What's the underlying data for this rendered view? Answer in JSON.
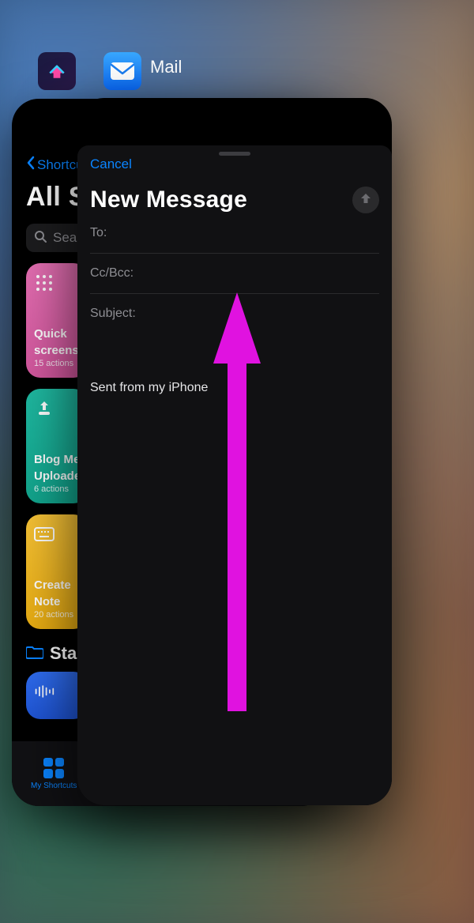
{
  "shortcuts": {
    "app_name": "Shortcuts",
    "back_label": "Shortcuts",
    "title": "All Shortcuts",
    "search_placeholder": "Search",
    "tiles": [
      {
        "title_line1": "Quick",
        "title_line2": "screenshot",
        "subtitle": "15 actions",
        "color": "pink",
        "icon": "grid-dots"
      },
      {
        "title_line1": "Blog Media",
        "title_line2": "Uploader",
        "subtitle": "6 actions",
        "color": "teal",
        "icon": "upload"
      },
      {
        "title_line1": "Create",
        "title_line2": "Note",
        "subtitle": "20 actions",
        "color": "yellow",
        "icon": "keyboard"
      }
    ],
    "section_label": "Starter Shortcuts",
    "tab_label": "My Shortcuts"
  },
  "mail": {
    "app_name": "Mail",
    "cancel_label": "Cancel",
    "title": "New Message",
    "to_label": "To:",
    "ccbcc_label": "Cc/Bcc:",
    "subject_label": "Subject:",
    "body_signature": "Sent from my iPhone"
  },
  "annotation": {
    "arrow_color": "#e012e0",
    "direction": "up"
  }
}
